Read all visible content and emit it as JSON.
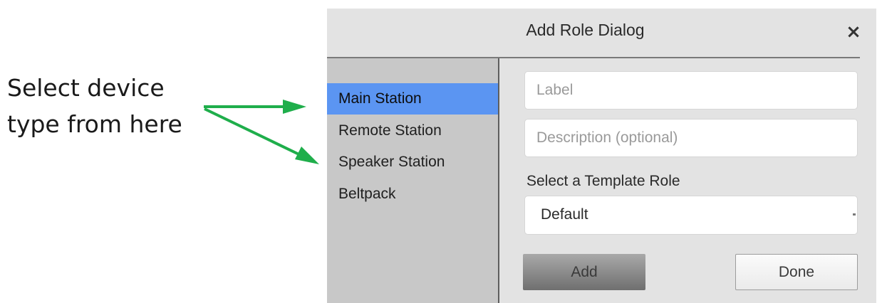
{
  "annotation": {
    "lines": [
      "Select device",
      "type from here"
    ],
    "arrow_color": "#1fae4b"
  },
  "dialog": {
    "title": "Add Role Dialog",
    "close_glyph": "×",
    "close_icon": "close-icon"
  },
  "sidebar": {
    "items": [
      {
        "label": "Main Station",
        "selected": true
      },
      {
        "label": "Remote Station",
        "selected": false
      },
      {
        "label": "Speaker Station",
        "selected": false
      },
      {
        "label": "Beltpack",
        "selected": false
      }
    ],
    "selected_color": "#5b95f2"
  },
  "form": {
    "label_placeholder": "Label",
    "description_placeholder": "Description (optional)",
    "template_label": "Select a Template Role",
    "template_value": "Default"
  },
  "buttons": {
    "add": "Add",
    "done": "Done"
  }
}
